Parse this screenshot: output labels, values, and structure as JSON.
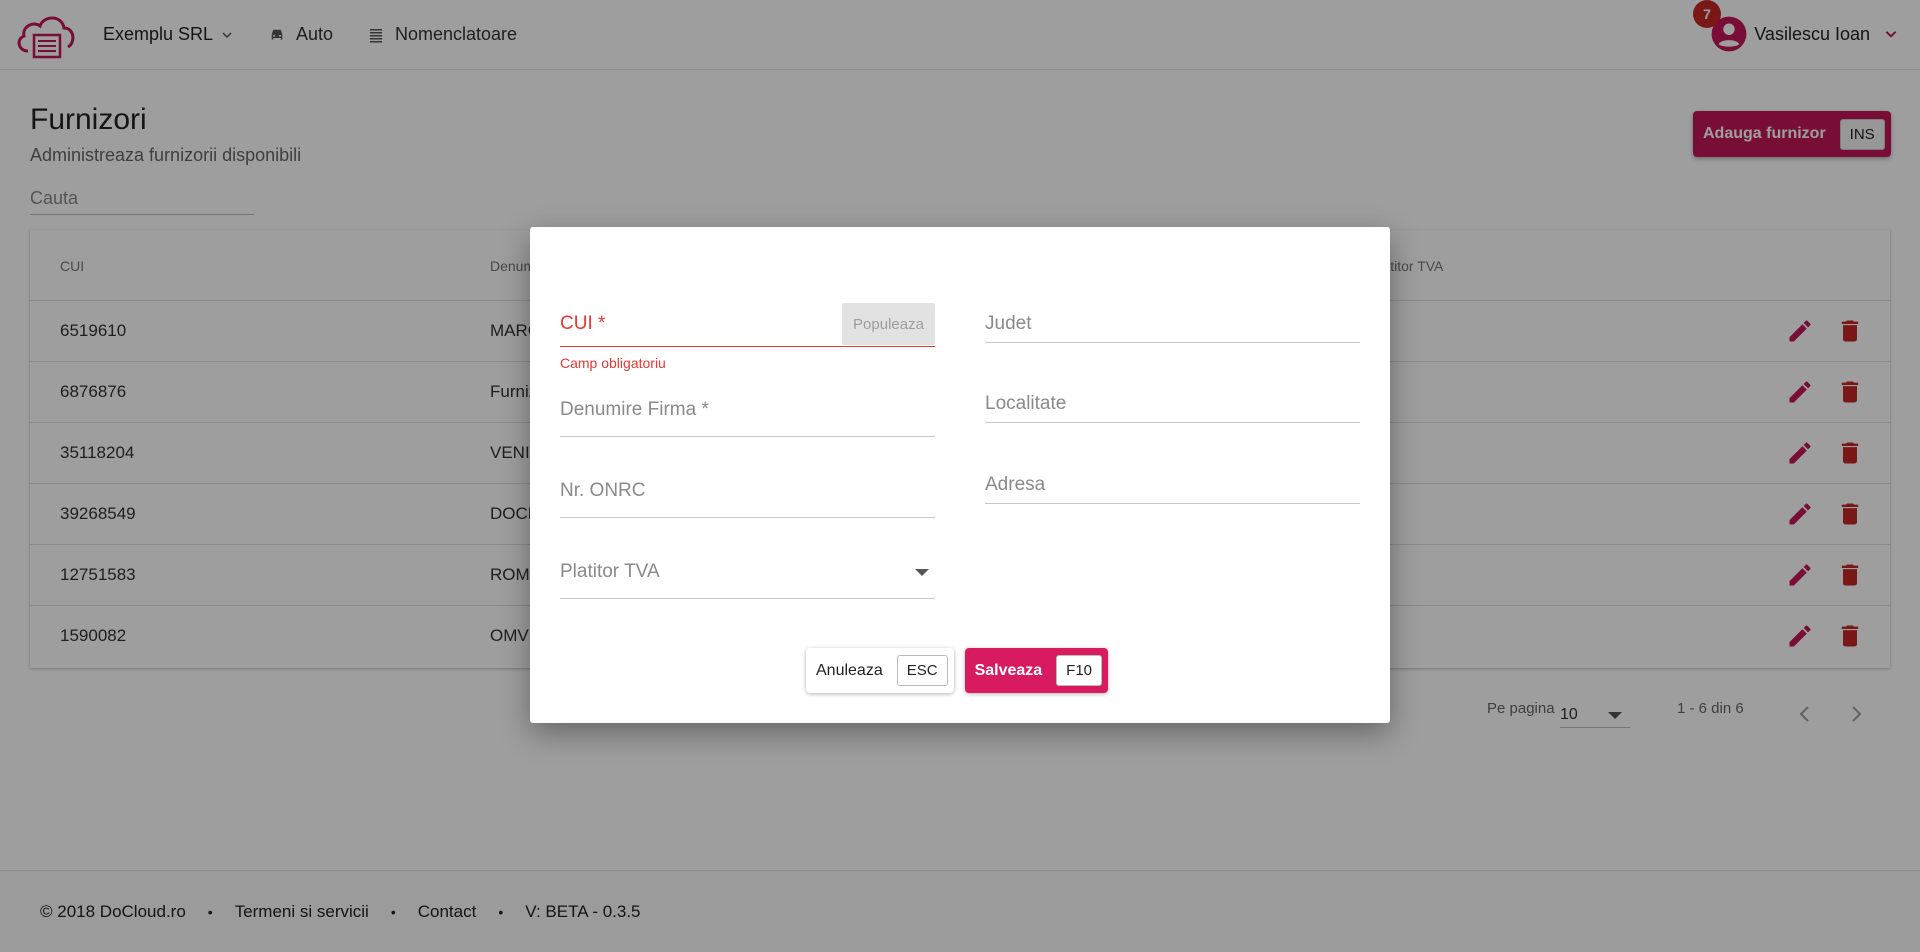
{
  "header": {
    "company": "Exemplu SRL",
    "nav": [
      {
        "label": "Auto",
        "icon": "car-icon"
      },
      {
        "label": "Nomenclatoare",
        "icon": "list-icon"
      }
    ],
    "notifications_count": "7",
    "user_name": "Vasilescu Ioan"
  },
  "page": {
    "title": "Furnizori",
    "subtitle": "Administreaza furnizorii disponibili",
    "search_placeholder": "Cauta",
    "add_button_label": "Adauga furnizor",
    "add_button_shortcut": "INS"
  },
  "table": {
    "columns": [
      "CUI",
      "Denumire",
      "Platitor TVA"
    ],
    "rows": [
      {
        "cui": "6519610",
        "name": "MARC"
      },
      {
        "cui": "6876876",
        "name": "Furniz"
      },
      {
        "cui": "35118204",
        "name": "VENII"
      },
      {
        "cui": "39268549",
        "name": "DOCL"
      },
      {
        "cui": "12751583",
        "name": "ROMI"
      },
      {
        "cui": "1590082",
        "name": "OMV"
      }
    ]
  },
  "pagination": {
    "per_page_label": "Pe pagina",
    "per_page_value": "10",
    "range": "1 - 6 din 6"
  },
  "footer": {
    "copyright": "© 2018 DoCloud.ro",
    "terms": "Termeni si servicii",
    "contact": "Contact",
    "version": "V: BETA - 0.3.5"
  },
  "dialog": {
    "cui_label": "CUI *",
    "cui_error": "Camp obligatoriu",
    "populeaza_label": "Populeaza",
    "denumire_label": "Denumire Firma *",
    "onrc_label": "Nr. ONRC",
    "platitor_label": "Platitor TVA",
    "judet_label": "Judet",
    "localitate_label": "Localitate",
    "adresa_label": "Adresa",
    "cancel_label": "Anuleaza",
    "cancel_shortcut": "ESC",
    "save_label": "Salveaza",
    "save_shortcut": "F10"
  },
  "colors": {
    "accent": "#c2185b",
    "accent_bright": "#d81b60",
    "error": "#e53935",
    "delete": "#c62828"
  }
}
